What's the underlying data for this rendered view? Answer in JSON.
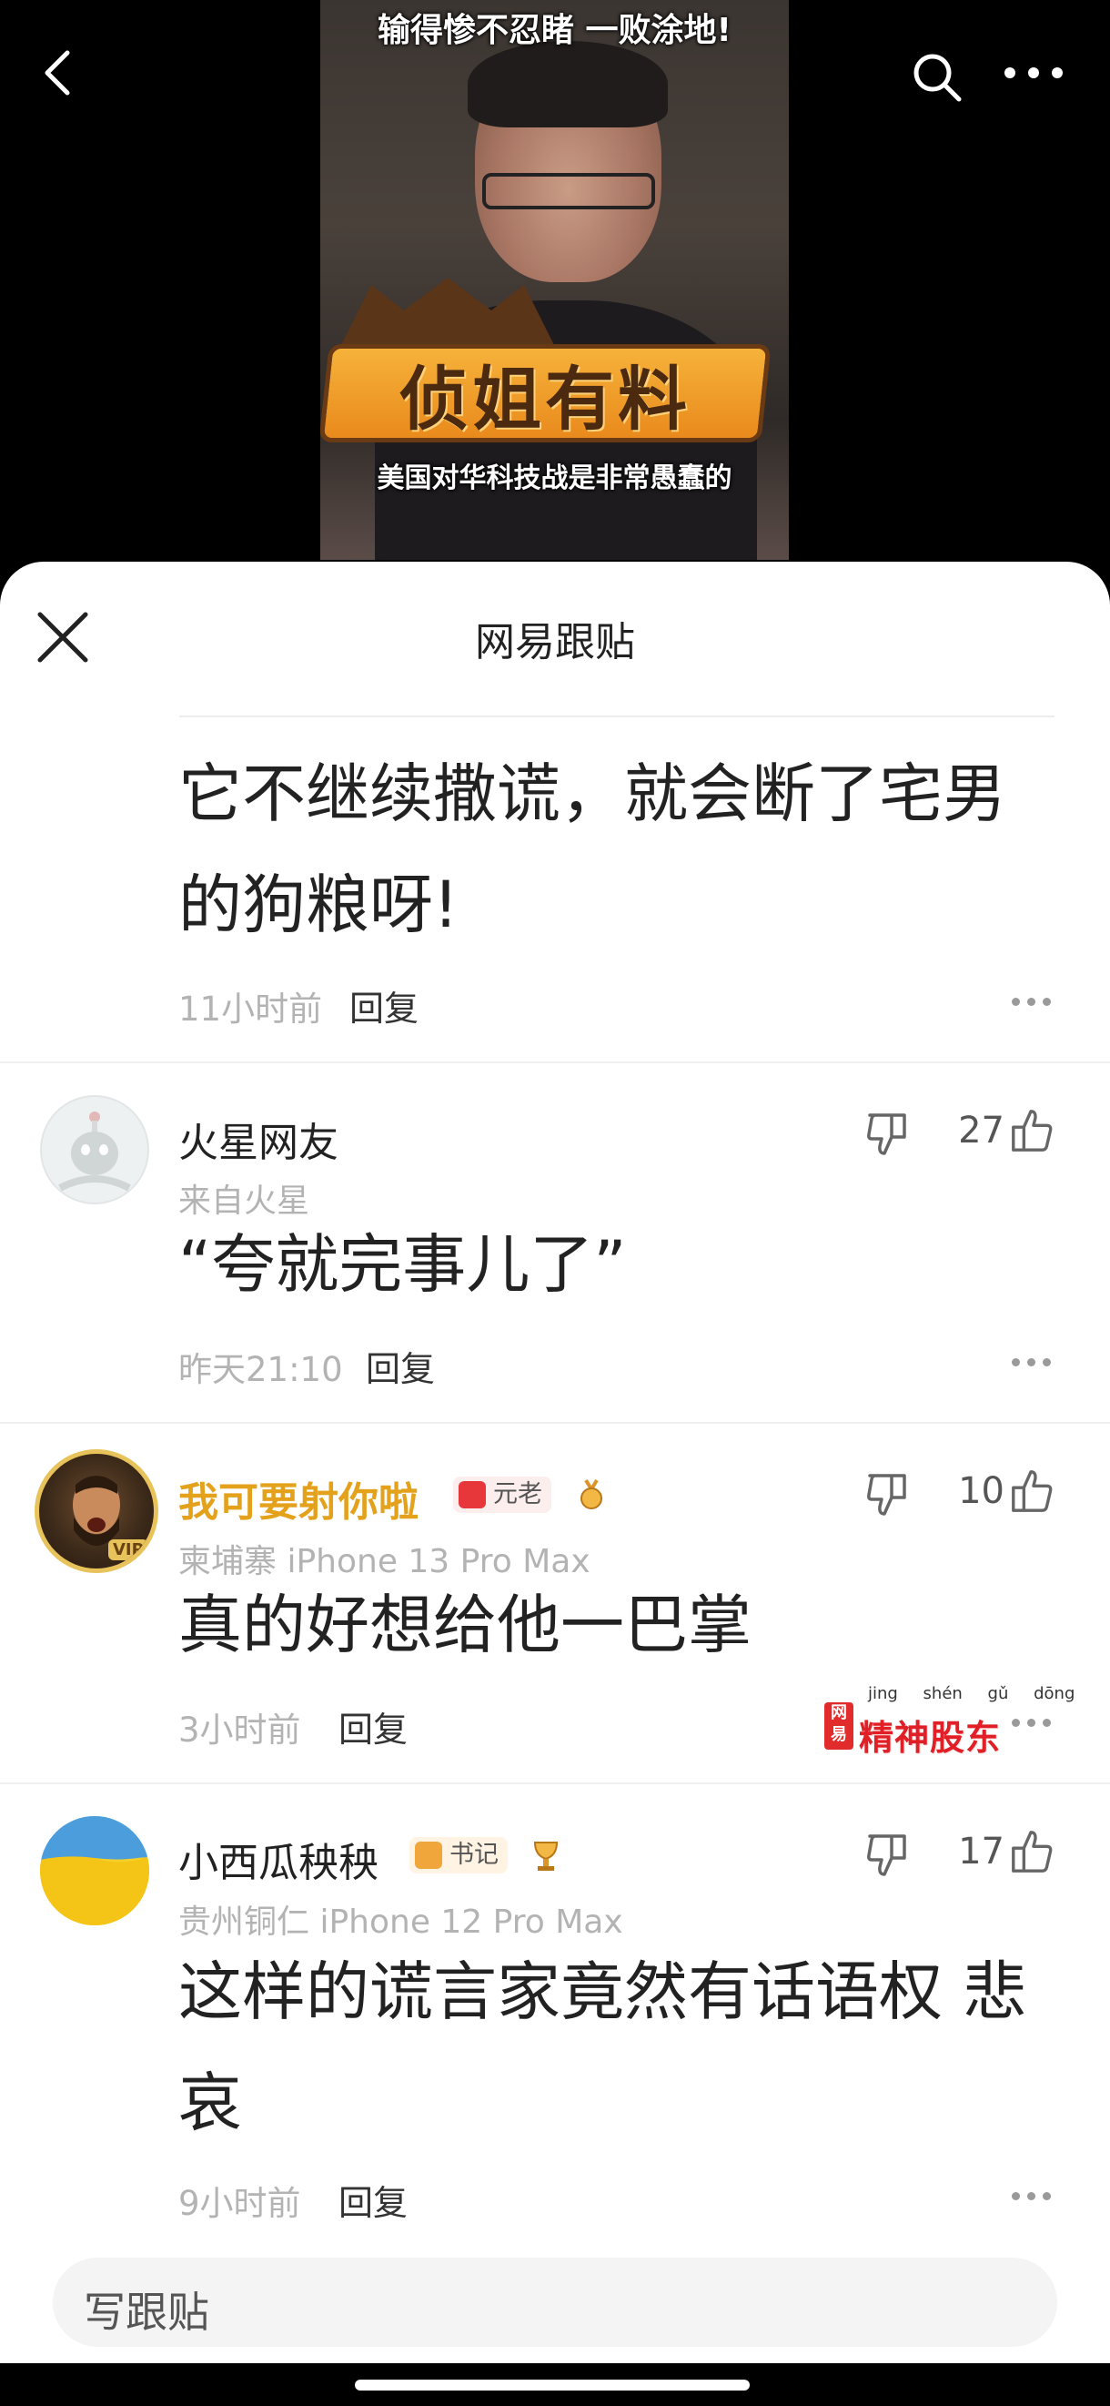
{
  "video": {
    "caption_top": "输得惨不忍睹 一败涂地!",
    "logo_text": "侦姐有料",
    "caption_bottom": "美国对华科技战是非常愚蠢的"
  },
  "sheet": {
    "title": "网易跟贴"
  },
  "comments": [
    {
      "body": "它不继续撒谎，就会断了宅男的狗粮呀!",
      "time": "11小时前",
      "reply": "回复"
    },
    {
      "username": "火星网友",
      "meta": "来自火星",
      "body": "“夸就完事儿了”",
      "time": "昨天21:10",
      "reply": "回复",
      "likes": "27"
    },
    {
      "username": "我可要射你啦",
      "badge": "元老",
      "avatar_tag": "VIP",
      "meta": "柬埔寨  iPhone 13 Pro Max",
      "body": "真的好想给他一巴掌",
      "time": "3小时前",
      "reply": "回复",
      "likes": "10"
    },
    {
      "username": "小西瓜秧秧",
      "badge": "书记",
      "meta": "贵州铜仁  iPhone 12 Pro Max",
      "body": "这样的谎言家竟然有话语权 悲哀",
      "time": "9小时前",
      "reply": "回复",
      "likes": "17"
    }
  ],
  "watermark": {
    "pinyin": "jing shén gǔ dōng",
    "box": "网易",
    "text": "精神股东"
  },
  "composer": {
    "placeholder": "写跟贴"
  },
  "colors": {
    "gold_username": "#e3a11c",
    "meta_gray": "#b3b3b3",
    "badge_red": "#e8373b",
    "badge_orange": "#f0a63a"
  },
  "icons": [
    "back-icon",
    "search-icon",
    "more-icon",
    "close-icon",
    "thumbs-down-icon",
    "thumbs-up-icon",
    "more-dots-icon",
    "medal-icon"
  ]
}
